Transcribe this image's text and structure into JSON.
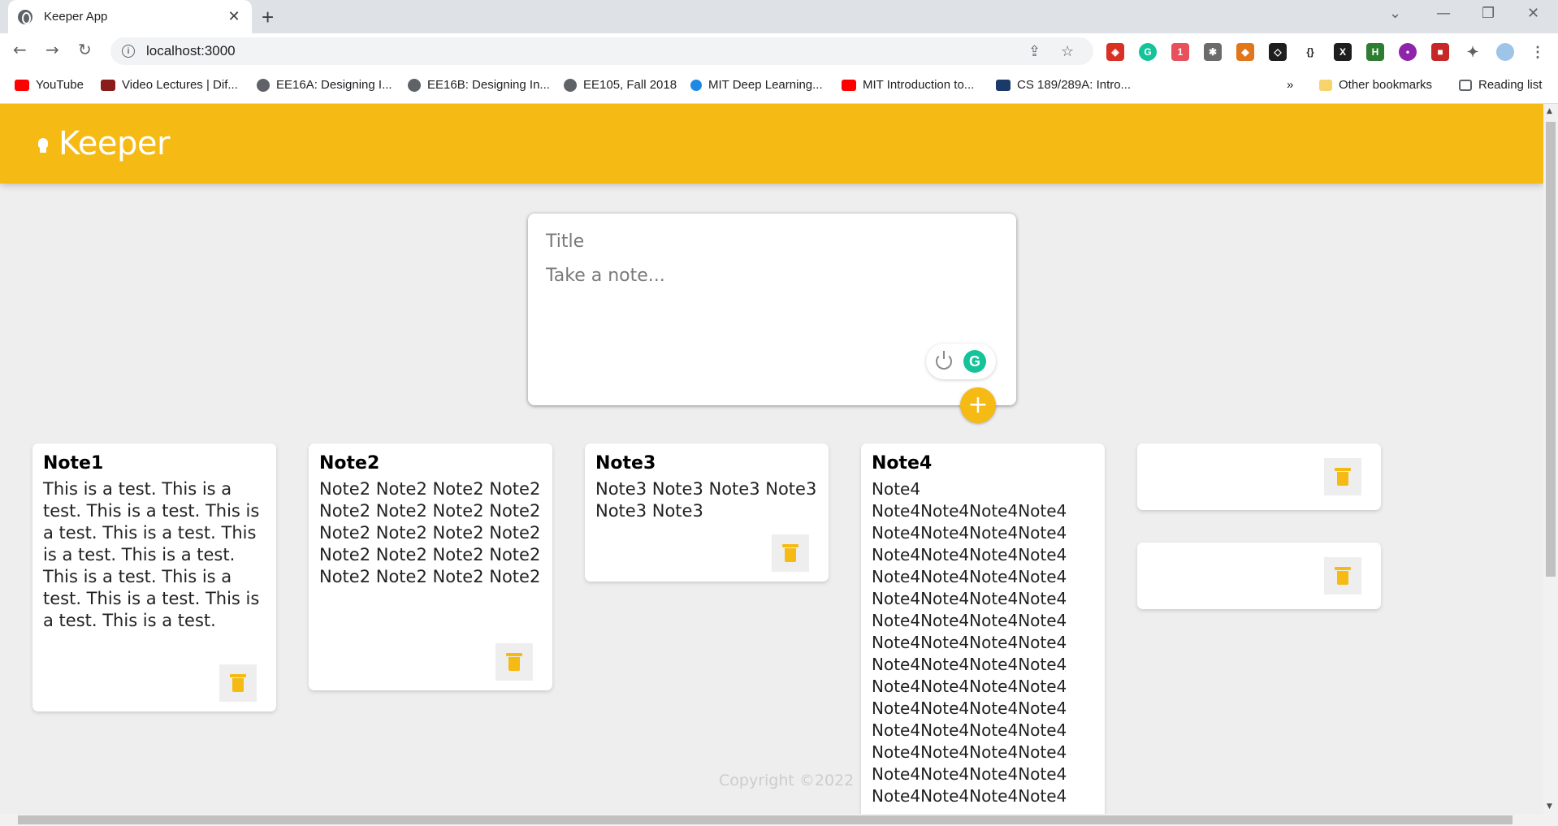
{
  "browser": {
    "tab_title": "Keeper App",
    "url": "localhost:3000",
    "bookmarks": [
      {
        "label": "YouTube",
        "icon": "youtube-icon"
      },
      {
        "label": "Video Lectures | Dif...",
        "icon": "mit-ocw-icon"
      },
      {
        "label": "EE16A: Designing I...",
        "icon": "globe-icon"
      },
      {
        "label": "EE16B: Designing In...",
        "icon": "globe-icon"
      },
      {
        "label": "EE105, Fall 2018",
        "icon": "globe-icon"
      },
      {
        "label": "MIT Deep Learning...",
        "icon": "share-icon"
      },
      {
        "label": "MIT Introduction to...",
        "icon": "youtube-icon"
      },
      {
        "label": "CS 189/289A: Intro...",
        "icon": "cs-icon"
      }
    ],
    "more_bookmarks": "»",
    "other_bookmarks": "Other bookmarks",
    "reading_list": "Reading list",
    "extension_badge": "1"
  },
  "app": {
    "brand": "Keeper",
    "accent_color": "#f5ba13",
    "create": {
      "title_placeholder": "Title",
      "content_placeholder": "Take a note...",
      "add_label": "+"
    },
    "notes": [
      {
        "title": "Note1",
        "content": "This is a test. This is a test. This is a test. This is a test. This is a test. This is a test. This is a test. This is a test. This is a test. This is a test. This is a test. This is a test."
      },
      {
        "title": "Note2",
        "content": "Note2 Note2 Note2 Note2 Note2 Note2 Note2 Note2 Note2 Note2 Note2 Note2 Note2 Note2 Note2 Note2 Note2 Note2 Note2 Note2"
      },
      {
        "title": "Note3",
        "content": "Note3 Note3 Note3 Note3 Note3 Note3"
      },
      {
        "title": "Note4",
        "content": "Note4\nNote4Note4Note4Note4\nNote4Note4Note4Note4\nNote4Note4Note4Note4\nNote4Note4Note4Note4\nNote4Note4Note4Note4\nNote4Note4Note4Note4\nNote4Note4Note4Note4\nNote4Note4Note4Note4\nNote4Note4Note4Note4\nNote4Note4Note4Note4\nNote4Note4Note4Note4\nNote4Note4Note4Note4\nNote4Note4Note4Note4\nNote4Note4Note4Note4"
      },
      {
        "title": "",
        "content": ""
      },
      {
        "title": "",
        "content": ""
      }
    ],
    "footer": "Copyright ©2022"
  }
}
